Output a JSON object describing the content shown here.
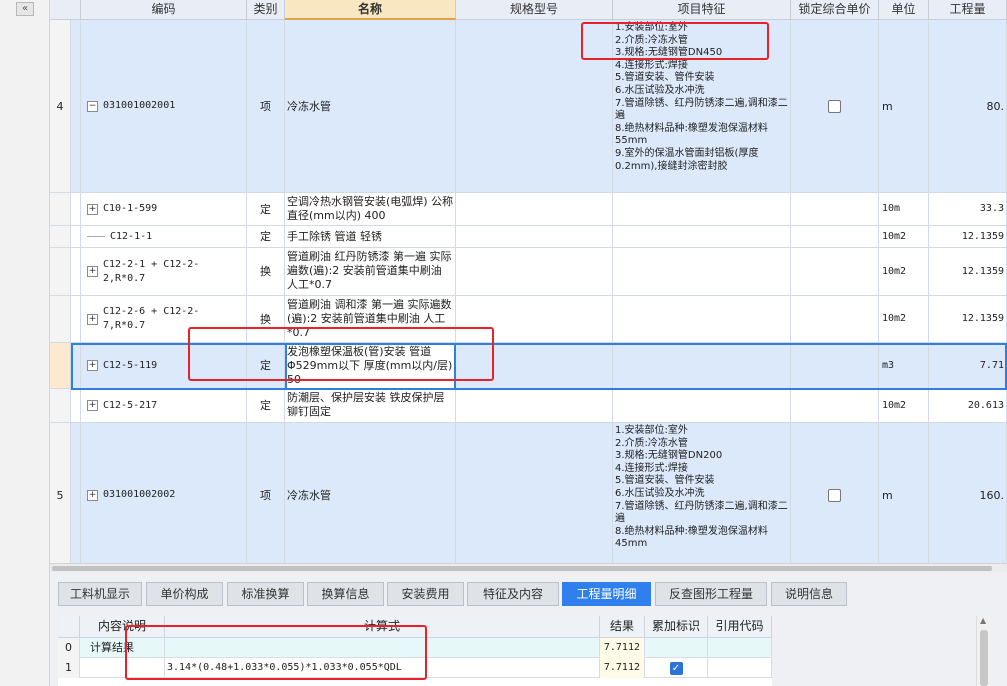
{
  "headers": {
    "code": "编码",
    "type": "类别",
    "name": "名称",
    "spec": "规格型号",
    "feature": "项目特征",
    "lock": "锁定综合单价",
    "unit": "单位",
    "qty": "工程量"
  },
  "rows": [
    {
      "index": "4",
      "code": "031001002001",
      "toggle": "−",
      "type": "项",
      "name": "冷冻水管",
      "feature": "1.安装部位:室外\n2.介质:冷冻水管\n3.规格:无缝钢管DN450\n4.连接形式:焊接\n5.管道安装、管件安装\n6.水压试验及水冲洗\n7.管道除锈、红丹防锈漆二遍,调和漆二遍\n8.绝热材料品种:橡塑发泡保温材料55mm\n9.室外的保温水管面封铝板(厚度0.2mm),接缝封涂密封胶",
      "unit": "m",
      "qty": "80."
    },
    {
      "index": "",
      "code": "C10-1-599",
      "toggle": "+",
      "type": "定",
      "name": "空调冷热水钢管安装(电弧焊) 公称直径(mm以内) 400",
      "feature": "",
      "unit": "10m",
      "qty": "33.3"
    },
    {
      "index": "",
      "code": "C12-1-1",
      "toggle": "",
      "type": "定",
      "name": "手工除锈 管道 轻锈",
      "feature": "",
      "unit": "10m2",
      "qty": "12.1359"
    },
    {
      "index": "",
      "code": "C12-2-1 + C12-2-2,R*0.7",
      "toggle": "+",
      "type": "换",
      "name": "管道刷油 红丹防锈漆 第一遍 实际遍数(遍):2 安装前管道集中刷油 人工*0.7",
      "feature": "",
      "unit": "10m2",
      "qty": "12.1359"
    },
    {
      "index": "",
      "code": "C12-2-6 + C12-2-7,R*0.7",
      "toggle": "+",
      "type": "换",
      "name": "管道刷油 调和漆 第一遍 实际遍数(遍):2 安装前管道集中刷油 人工*0.7",
      "feature": "",
      "unit": "10m2",
      "qty": "12.1359"
    },
    {
      "index": "",
      "code": "C12-5-119",
      "toggle": "+",
      "type": "定",
      "name": "发泡橡塑保温板(管)安装 管道Φ529mm以下 厚度(mm以内/层) 50",
      "feature": "",
      "unit": "m3",
      "qty": "7.71"
    },
    {
      "index": "",
      "code": "C12-5-217",
      "toggle": "+",
      "type": "定",
      "name": "防潮层、保护层安装 铁皮保护层 铆钉固定",
      "feature": "",
      "unit": "10m2",
      "qty": "20.613"
    },
    {
      "index": "5",
      "code": "031001002002",
      "toggle": "+",
      "type": "项",
      "name": "冷冻水管",
      "feature": "1.安装部位:室外\n2.介质:冷冻水管\n3.规格:无缝钢管DN200\n4.连接形式:焊接\n5.管道安装、管件安装\n6.水压试验及水冲洗\n7.管道除锈、红丹防锈漆二遍,调和漆二遍\n8.绝热材料品种:橡塑发泡保温材料45mm",
      "unit": "m",
      "qty": "160."
    }
  ],
  "tabs": [
    "工料机显示",
    "单价构成",
    "标准换算",
    "换算信息",
    "安装费用",
    "特征及内容",
    "工程量明细",
    "反查图形工程量",
    "说明信息"
  ],
  "active_tab": "工程量明细",
  "detail": {
    "headers": {
      "desc": "内容说明",
      "formula": "计算式",
      "result": "结果",
      "flag": "累加标识",
      "ref": "引用代码"
    },
    "rows": [
      {
        "index": "0",
        "desc": "计算结果",
        "formula": "",
        "result": "7.7112",
        "flag": false,
        "ref": ""
      },
      {
        "index": "1",
        "desc": "",
        "formula": "3.14*(0.48+1.033*0.055)*1.033*0.055*QDL",
        "result": "7.7112",
        "flag": true,
        "ref": ""
      }
    ]
  },
  "colors": {
    "selected_row": "#dce9fb",
    "active_tab": "#2f80ed",
    "highlight_box": "#e8222a",
    "header_name": "#f8e7c0"
  }
}
